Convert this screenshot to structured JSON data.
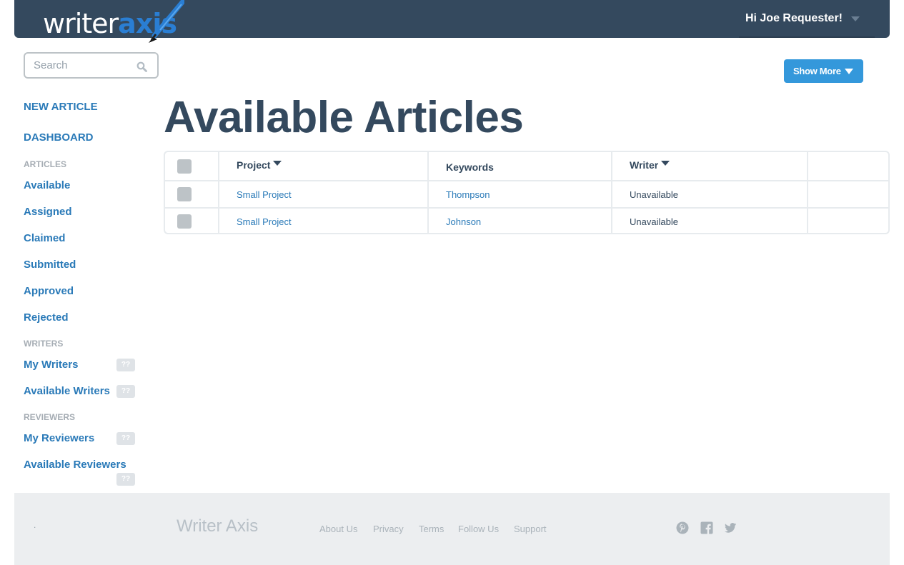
{
  "header": {
    "logo_text_white": "writer",
    "logo_text_blue": "axis",
    "greeting": "Hi Joe Requester!"
  },
  "search": {
    "placeholder": "Search"
  },
  "sidebar": {
    "new_article": "NEW ARTICLE",
    "dashboard": "DASHBOARD",
    "articles_heading": "ARTICLES",
    "articles": [
      "Available",
      "Assigned",
      "Claimed",
      "Submitted",
      "Approved",
      "Rejected"
    ],
    "writers_heading": "WRITERS",
    "writers": [
      {
        "label": "My Writers",
        "badge": "??"
      },
      {
        "label": "Available Writers",
        "badge": "??"
      }
    ],
    "reviewers_heading": "REVIEWERS",
    "reviewers": [
      {
        "label": "My Reviewers",
        "badge": "??"
      },
      {
        "label": "Available Reviewers",
        "badge": "??"
      }
    ]
  },
  "show_more_label": "Show More",
  "page_title": "Available Articles",
  "table": {
    "columns": [
      "Project",
      "Keywords",
      "Writer"
    ],
    "rows": [
      {
        "project": "Small Project",
        "keywords": "Thompson",
        "writer": "Unavailable"
      },
      {
        "project": "Small Project",
        "keywords": "Johnson",
        "writer": "Unavailable"
      }
    ]
  },
  "footer": {
    "dot": ".",
    "brand": "Writer Axis",
    "links": [
      "About Us",
      "Privacy",
      "Terms",
      "Follow Us",
      "Support"
    ],
    "social_icons": [
      "pinterest-icon",
      "facebook-icon",
      "twitter-icon"
    ]
  },
  "colors": {
    "topbar": "#34495e",
    "link": "#2a7ab8",
    "button": "#3498db",
    "footer": "#eceef0"
  }
}
